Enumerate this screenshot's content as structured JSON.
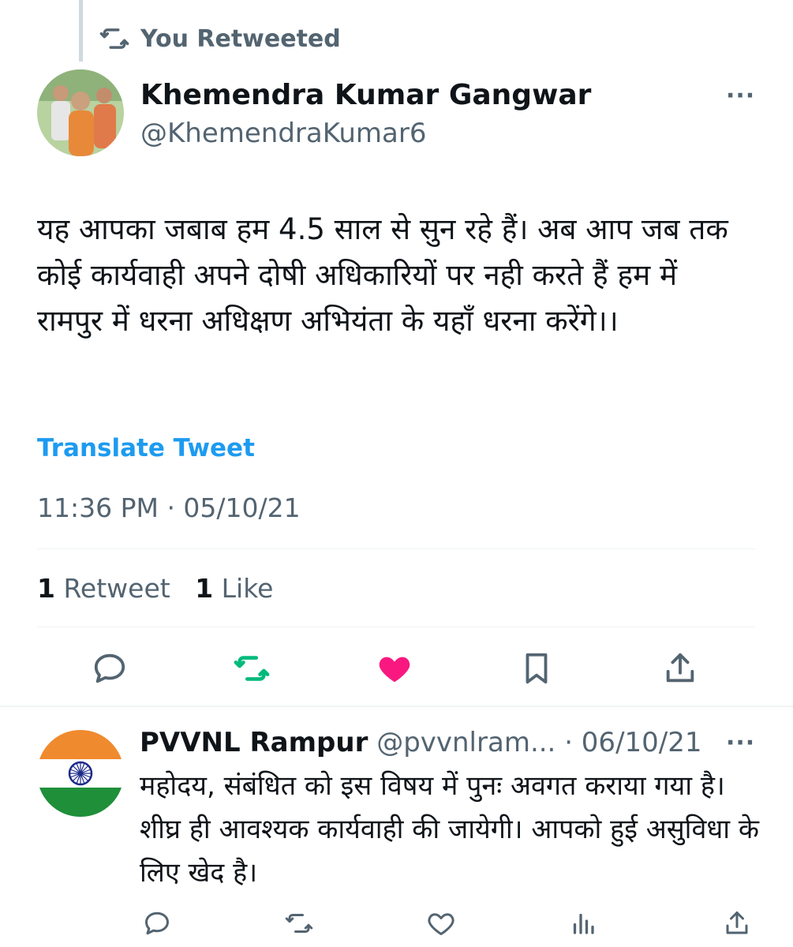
{
  "retweet_banner": {
    "label": "You Retweeted"
  },
  "tweet": {
    "author_name": "Khemendra Kumar Gangwar",
    "author_handle": "@KhemendraKumar6",
    "more_label": "···",
    "text": "यह आपका जबाब हम 4.5 साल से सुन रहे हैं। अब आप जब तक कोई कार्यवाही अपने दोषी अधिकारियों पर नही करते हैं हम में रामपुर में धरना अधिक्षण अभियंता के यहाँ धरना करेंगे।।",
    "translate_label": "Translate Tweet",
    "timestamp": "11:36 PM · 05/10/21",
    "retweet_count": "1",
    "retweet_label": "Retweet",
    "like_count": "1",
    "like_label": "Like"
  },
  "reply": {
    "author_name": "PVVNL Rampur",
    "author_handle": "@pvvnlram...",
    "date": "· 06/10/21",
    "more_label": "···",
    "text": "महोदय, संबंधित को इस विषय में पुनः अवगत कराया गया है। शीघ्र ही आवश्यक कार्यवाही की जायेगी। आपको हुई असुविधा के लिए खेद है।"
  },
  "icons": {
    "retweet": "retweet-icon",
    "reply": "reply-icon",
    "like": "heart-icon",
    "bookmark": "bookmark-icon",
    "share": "share-icon",
    "views": "views-icon",
    "more": "more-icon"
  },
  "colors": {
    "text_primary": "#0f1419",
    "text_secondary": "#536471",
    "link": "#1d9bf0",
    "retweet_active": "#00ba7c",
    "like_active": "#f91880",
    "divider": "#eff3f4"
  }
}
